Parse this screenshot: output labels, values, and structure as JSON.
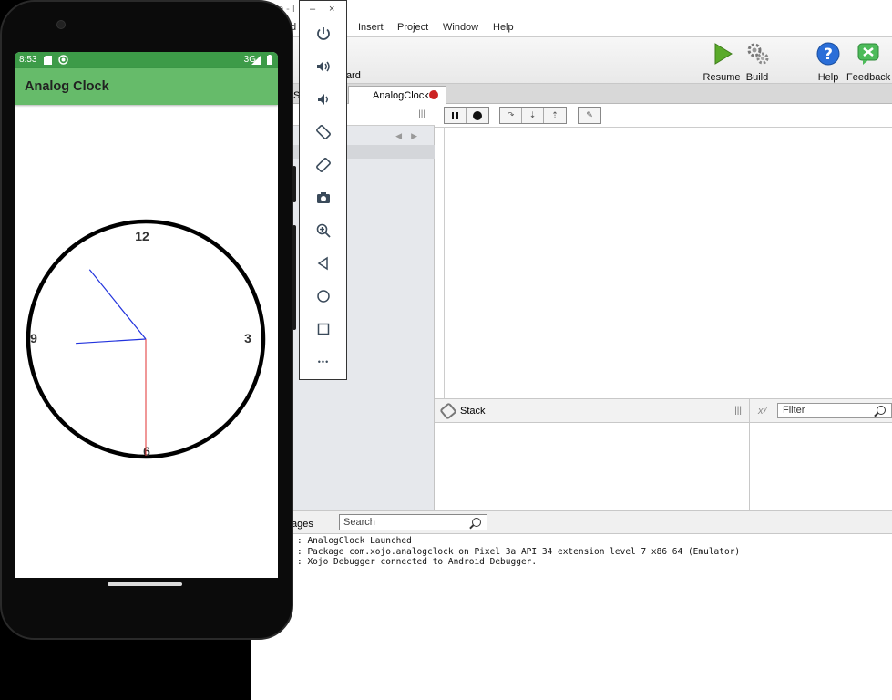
{
  "ide": {
    "title_fragment": "o - I",
    "menu": [
      {
        "key": "file_frag",
        "label": "d"
      },
      {
        "key": "insert",
        "label": "Insert"
      },
      {
        "key": "project",
        "label": "Project"
      },
      {
        "key": "window",
        "label": "Window"
      },
      {
        "key": "help",
        "label": "Help"
      }
    ],
    "toolbar": {
      "forward_fragment": "ward",
      "resume": "Resume",
      "build": "Build",
      "help": "Help",
      "feedback": "Feedback"
    },
    "tabs": {
      "partial": "S",
      "active": "AnalogClock"
    },
    "stack_title": "Stack",
    "vars_label": "xʸ",
    "filter_placeholder": "Filter",
    "messages_fragment": "ages",
    "search_placeholder": "Search",
    "messages": [
      ": AnalogClock Launched",
      ": Package com.xojo.analogclock on Pixel 3a API 34 extension level 7 x86 64 (Emulator)",
      ": Xojo Debugger connected to Android Debugger."
    ],
    "colors": {
      "resume_green": "#5aaa2a",
      "help_blue": "#2a6ed8",
      "feedback_green": "#4dbb5a"
    }
  },
  "emulator_controls": {
    "minimize": "–",
    "close": "×",
    "more": "•••"
  },
  "phone": {
    "status_time": "8:53",
    "status_network": "3G",
    "app_title": "Analog Clock",
    "clock": {
      "labels": {
        "n12": "12",
        "n3": "3",
        "n6": "6",
        "n9": "9"
      },
      "time_hours": 8,
      "time_minutes": 53,
      "time_seconds": 30,
      "hand_color": "#2233dd",
      "second_hand_color": "#e03030",
      "status_bar_color": "#3d9b48",
      "app_bar_color": "#66bb6a"
    }
  }
}
